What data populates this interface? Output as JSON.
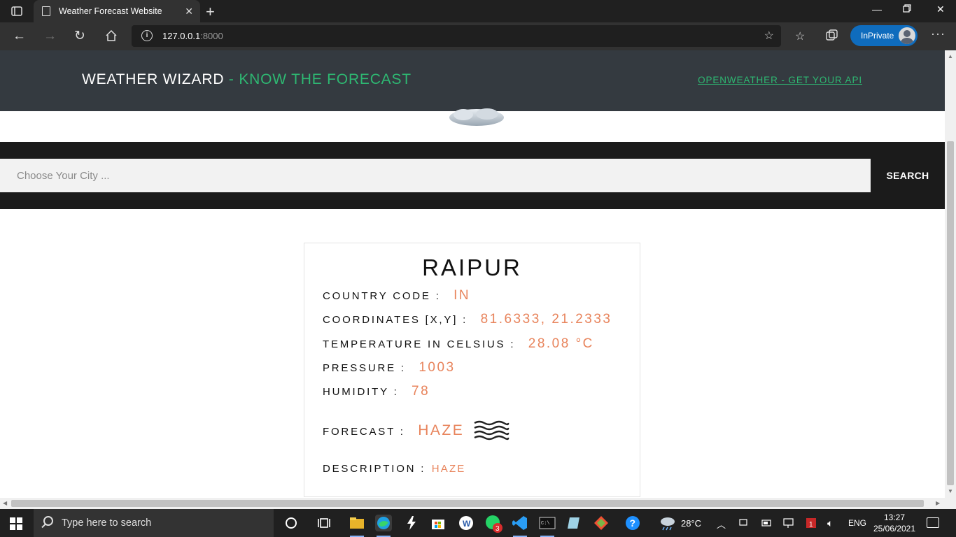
{
  "browser": {
    "tab_title": "Weather Forecast Website",
    "url_host": "127.0.0.1",
    "url_port": ":8000",
    "inprivate_label": "InPrivate"
  },
  "site": {
    "brand_main": "WEATHER WIZARD",
    "brand_accent": " - KNOW THE FORECAST",
    "api_link": "OPENWEATHER - GET YOUR API",
    "accent_color": "#2eb872",
    "value_color": "#e8845c"
  },
  "search": {
    "placeholder": "Choose Your City ...",
    "button_label": "SEARCH"
  },
  "weather": {
    "city": "RAIPUR",
    "country_code_label": "COUNTRY CODE :",
    "country_code": "IN",
    "coordinates_label": "COORDINATES [X,Y] :",
    "coordinates": "81.6333, 21.2333",
    "temperature_label": "TEMPERATURE IN CELSIUS :",
    "temperature": "28.08 °C",
    "pressure_label": "PRESSURE :",
    "pressure": "1003",
    "humidity_label": "HUMIDITY :",
    "humidity": "78",
    "forecast_label": "FORECAST :",
    "forecast": "HAZE",
    "forecast_icon": "haze-icon",
    "description_label": "DESCRIPTION :",
    "description": "HAZE"
  },
  "taskbar": {
    "search_placeholder": "Type here to search",
    "weather_temp": "28°C",
    "language": "ENG",
    "time": "13:27",
    "date": "25/06/2021",
    "whatsapp_badge": "3",
    "app_badge": "1"
  }
}
